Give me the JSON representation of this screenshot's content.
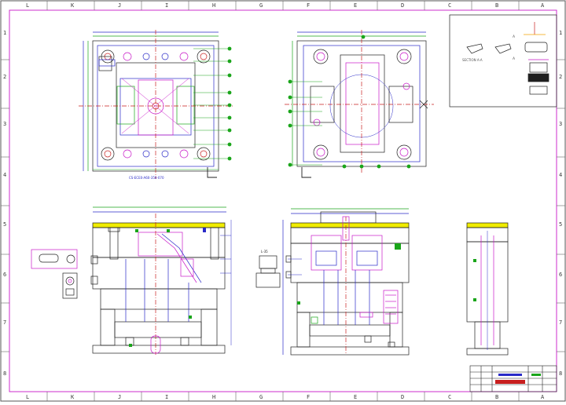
{
  "frame": {
    "columns": [
      "L",
      "K",
      "J",
      "I",
      "H",
      "G",
      "F",
      "E",
      "D",
      "C",
      "B",
      "A"
    ],
    "rows": [
      "1",
      "2",
      "3",
      "4",
      "5",
      "6",
      "7",
      "8"
    ]
  },
  "views": {
    "top_left_caption": "CS-ECE0-A60-350-070",
    "section_left_label": "L",
    "section_right_label": "L",
    "detail_section_title": "SECTION A-A",
    "detail_section_marker": "A",
    "detail_section_marker_2": "A",
    "small_detail_label": "L-35",
    "callout_label": "B"
  },
  "colors": {
    "outline": "#202020",
    "construction": "#2a2ac8",
    "dimension": "#1aa51a",
    "centerline": "#c81e1e",
    "callout": "#c818c8",
    "plate": "#f0ec00",
    "title_block": "#c81e1e"
  }
}
